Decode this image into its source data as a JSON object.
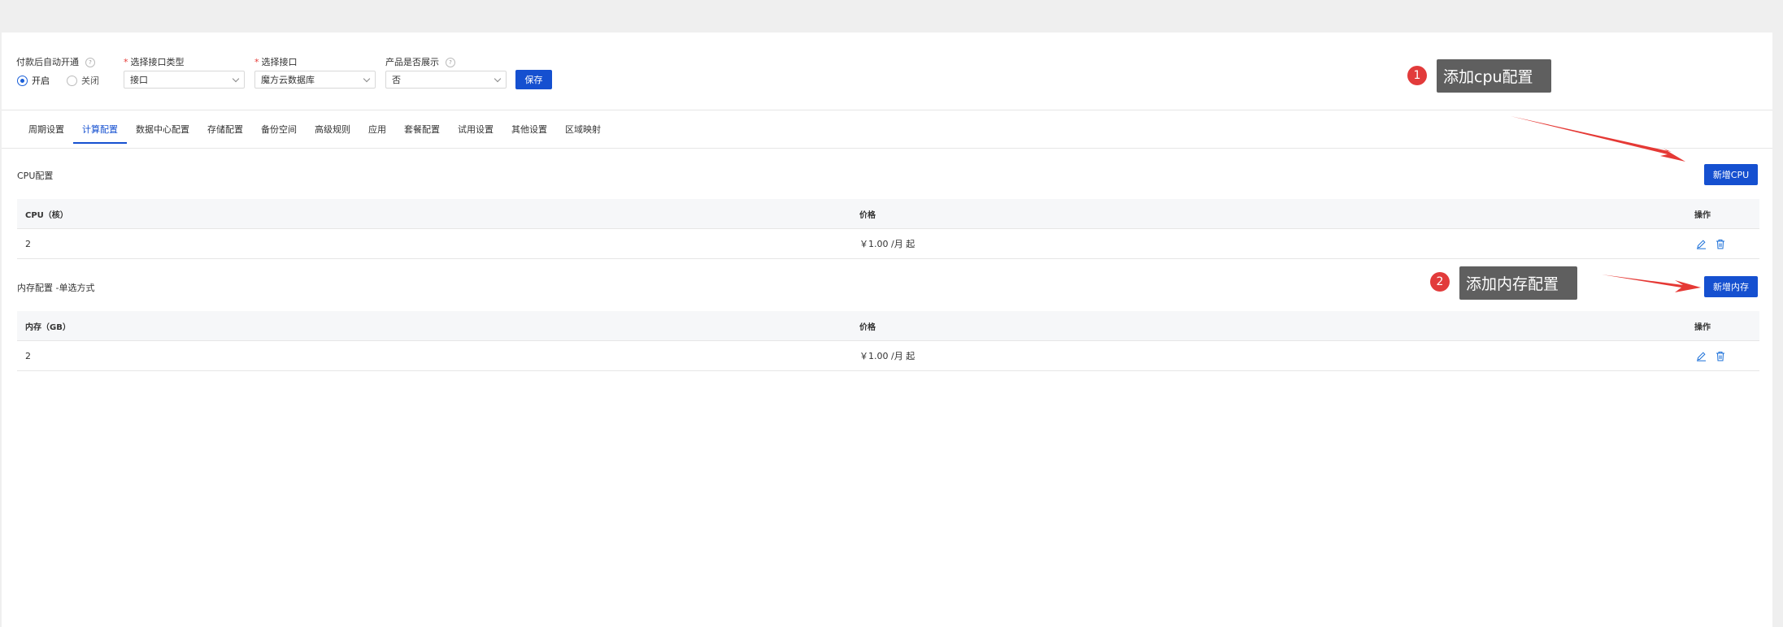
{
  "form": {
    "auto_open": {
      "label": "付款后自动开通",
      "help": "?",
      "options": [
        {
          "label": "开启",
          "selected": true
        },
        {
          "label": "关闭",
          "selected": false
        }
      ]
    },
    "interface_type": {
      "label": "选择接口类型",
      "required_mark": "*",
      "value": "接口"
    },
    "interface": {
      "label": "选择接口",
      "required_mark": "*",
      "value": "魔方云数据库"
    },
    "show_product": {
      "label": "产品是否展示",
      "help": "?",
      "value": "否"
    },
    "save_label": "保存"
  },
  "tabs": [
    {
      "label": "周期设置",
      "active": false
    },
    {
      "label": "计算配置",
      "active": true
    },
    {
      "label": "数据中心配置",
      "active": false
    },
    {
      "label": "存储配置",
      "active": false
    },
    {
      "label": "备份空间",
      "active": false
    },
    {
      "label": "高级规则",
      "active": false
    },
    {
      "label": "应用",
      "active": false
    },
    {
      "label": "套餐配置",
      "active": false
    },
    {
      "label": "试用设置",
      "active": false
    },
    {
      "label": "其他设置",
      "active": false
    },
    {
      "label": "区域映射",
      "active": false
    }
  ],
  "cpu": {
    "title": "CPU配置",
    "add_label": "新增CPU",
    "columns": [
      "CPU（核）",
      "价格",
      "操作"
    ],
    "rows": [
      {
        "value": "2",
        "price": "￥1.00 /月  起"
      }
    ]
  },
  "memory": {
    "title": "内存配置 -单选方式",
    "add_label": "新增内存",
    "columns": [
      "内存（GB）",
      "价格",
      "操作"
    ],
    "rows": [
      {
        "value": "2",
        "price": "￥1.00 /月  起"
      }
    ]
  },
  "annotations": [
    {
      "number": "1",
      "text": "添加cpu配置"
    },
    {
      "number": "2",
      "text": "添加内存配置"
    }
  ],
  "colors": {
    "primary": "#1550d0",
    "annotation_badge": "#e23b3b",
    "annotation_box": "#5f5f5f",
    "arrow": "#e53935"
  }
}
